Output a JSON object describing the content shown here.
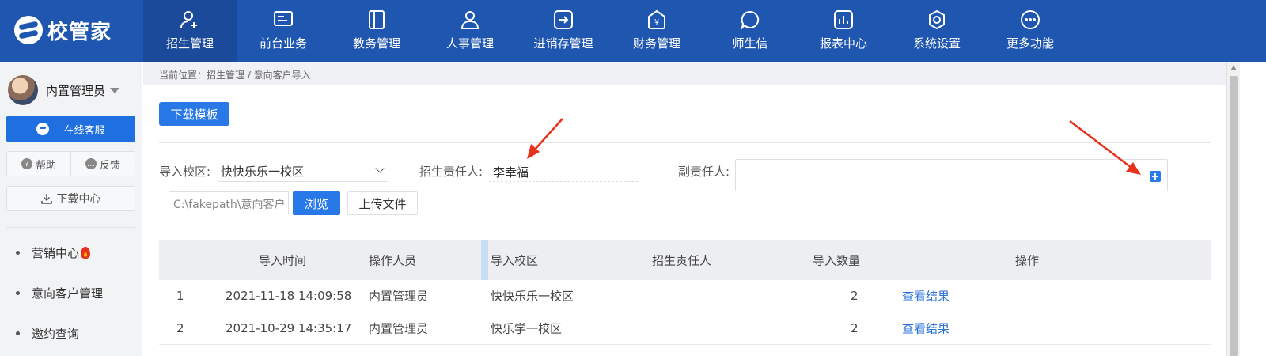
{
  "brand": {
    "name": "校管家"
  },
  "nav": [
    {
      "label": "招生管理",
      "icon": "user-plus-icon",
      "active": true
    },
    {
      "label": "前台业务",
      "icon": "monitor-icon"
    },
    {
      "label": "教务管理",
      "icon": "book-icon"
    },
    {
      "label": "人事管理",
      "icon": "person-icon"
    },
    {
      "label": "进销存管理",
      "icon": "inventory-icon"
    },
    {
      "label": "财务管理",
      "icon": "finance-icon"
    },
    {
      "label": "师生信",
      "icon": "chat-icon"
    },
    {
      "label": "报表中心",
      "icon": "report-icon"
    },
    {
      "label": "系统设置",
      "icon": "settings-icon"
    },
    {
      "label": "更多功能",
      "icon": "more-icon"
    }
  ],
  "sidebar": {
    "user_name": "内置管理员",
    "service_label": "在线客服",
    "help_label": "帮助",
    "feedback_label": "反馈",
    "download_center_label": "下载中心",
    "menu": [
      "营销中心",
      "意向客户管理",
      "邀约查询"
    ]
  },
  "breadcrumb": "当前位置：招生管理 / 意向客户导入",
  "main": {
    "download_template_label": "下载模板",
    "campus_label": "导入校区:",
    "campus_value": "快快乐乐一校区",
    "owner_label": "招生责任人:",
    "owner_value": "李幸福",
    "deputy_label": "副责任人:",
    "file_path": "C:\\fakepath\\意向客户",
    "browse_label": "浏览",
    "upload_label": "上传文件"
  },
  "table": {
    "headers": [
      "导入时间",
      "操作人员",
      "导入校区",
      "招生责任人",
      "导入数量",
      "操作"
    ],
    "rows": [
      {
        "index": "1",
        "time": "2021-11-18 14:09:58",
        "operator": "内置管理员",
        "campus": "快快乐乐一校区",
        "owner": "",
        "count": "2",
        "action": "查看结果"
      },
      {
        "index": "2",
        "time": "2021-10-29 14:35:17",
        "operator": "内置管理员",
        "campus": "快乐学一校区",
        "owner": "",
        "count": "2",
        "action": "查看结果"
      }
    ]
  },
  "colors": {
    "nav_bg": "#1f56b0",
    "primary": "#2878e8",
    "link": "#2a72d8",
    "annotation": "#e8301a"
  }
}
